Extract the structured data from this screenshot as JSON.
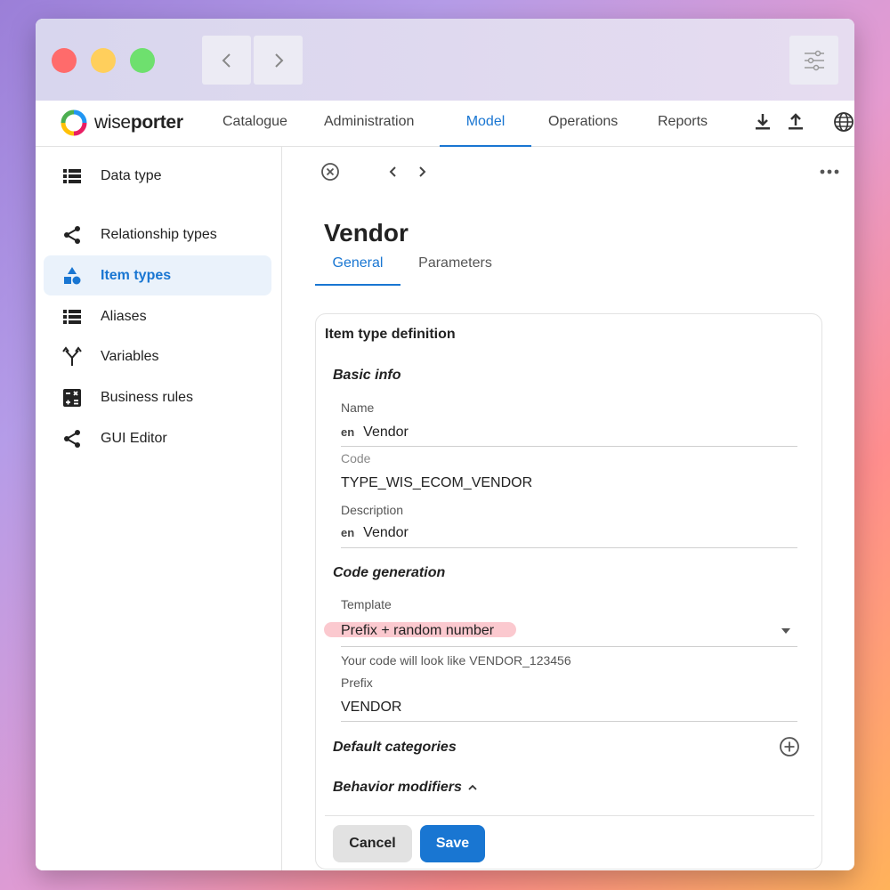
{
  "logo": {
    "part1": "wise",
    "part2": "porter"
  },
  "topnav": {
    "items": [
      {
        "label": "Catalogue"
      },
      {
        "label": "Administration"
      },
      {
        "label": "Model"
      },
      {
        "label": "Operations"
      },
      {
        "label": "Reports"
      }
    ],
    "active": "Model"
  },
  "sidebar": {
    "items": [
      {
        "label": "Data type",
        "icon": "list-icon"
      },
      {
        "label": "Relationship types",
        "icon": "share-icon"
      },
      {
        "label": "Item types",
        "icon": "shapes-icon"
      },
      {
        "label": "Aliases",
        "icon": "list-icon"
      },
      {
        "label": "Variables",
        "icon": "fork-icon"
      },
      {
        "label": "Business rules",
        "icon": "calculator-icon"
      },
      {
        "label": "GUI Editor",
        "icon": "share-icon"
      }
    ],
    "active": "Item types"
  },
  "page": {
    "title": "Vendor",
    "tabs": [
      {
        "label": "General"
      },
      {
        "label": "Parameters"
      }
    ]
  },
  "form": {
    "card_title": "Item type definition",
    "basic_info": "Basic info",
    "name_label": "Name",
    "name_lang": "en",
    "name_value": "Vendor",
    "code_label": "Code",
    "code_value": "TYPE_WIS_ECOM_VENDOR",
    "description_label": "Description",
    "description_lang": "en",
    "description_value": "Vendor",
    "code_generation": "Code generation",
    "template_label": "Template",
    "template_value": "Prefix + random number",
    "template_helper": "Your code will look like VENDOR_123456",
    "prefix_label": "Prefix",
    "prefix_value": "VENDOR",
    "default_categories": "Default categories",
    "behavior_modifiers": "Behavior modifiers"
  },
  "actions": {
    "cancel": "Cancel",
    "save": "Save"
  },
  "colors": {
    "accent": "#1976d2",
    "highlight": "#fbc9cf",
    "active_bg": "#eaf2fb"
  }
}
